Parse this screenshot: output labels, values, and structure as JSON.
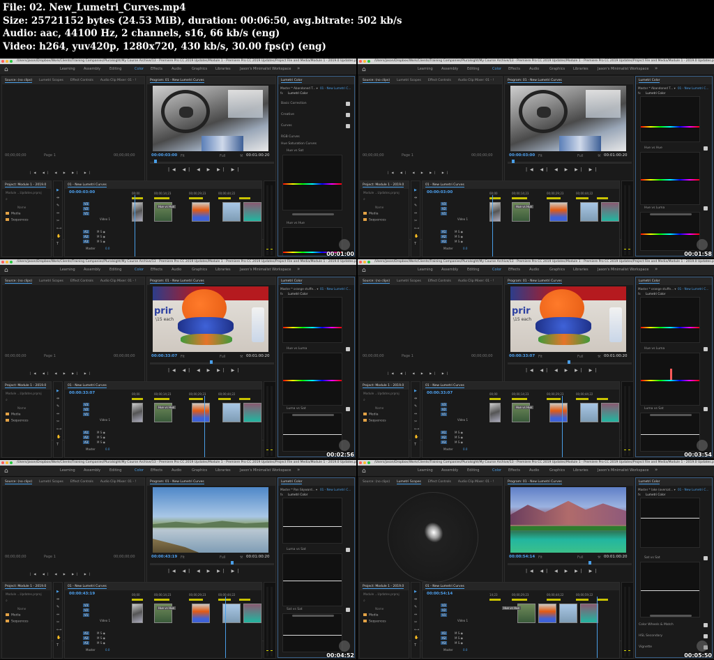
{
  "header": {
    "file_line": "File: 02. New_Lumetri_Curves.mp4",
    "size_line": "Size: 25721152 bytes (24.53 MiB), duration: 00:06:50, avg.bitrate: 502 kb/s",
    "audio_line": "Audio: aac, 44100 Hz, 2 channels, s16, 66 kb/s (eng)",
    "video_line": "Video: h264, yuv420p, 1280x720, 430 kb/s, 30.00 fps(r) (eng)"
  },
  "app": {
    "titlebar_text": "/Users/jason/Dropbox/Work/Clients/Training Companies/Pluralsight/My Course Archive/13 - Premiere Pro CC 2019 Updates/Module 1 - Premiere Pro CC 2019 Updates/Project File and Media/Module 1 - 2019.0 Updates.prproj *",
    "workspaces": [
      "Learning",
      "Assembly",
      "Editing",
      "Color",
      "Effects",
      "Audio",
      "Graphics",
      "Libraries",
      "Jason's Minimalist Workspace"
    ],
    "active_workspace": "Color",
    "more_chevron": "»",
    "home_icon": "⌂"
  },
  "common": {
    "source_tabs": [
      "Source: (no clips)",
      "Lumetri Scopes",
      "Effect Controls",
      "Audio Clip Mixer: 01 - !"
    ],
    "program_tab": "Program: 01 - New Lumetri Curves",
    "lumetri_tab": "Lumetri Color",
    "lumetri_fx": "Lumetri Color",
    "project_tab": "Project: Module 1 - 2019.0",
    "project_file": "Module ...Updates.prproj",
    "project_name_header": "Name",
    "project_items": [
      "Media",
      "Sequences"
    ],
    "sequence_tab": "01 - New Lumetri Curves",
    "source_tc_left": "00;00;00;00",
    "source_page": "Page 1",
    "source_tc_right": "00;00;00;00",
    "fit_label": "Fit",
    "full_label": "Full",
    "duration": "00:01:00:20",
    "ruler": [
      "00;00",
      "00;00;14;23",
      "00;00;29;23",
      "00;00;44;22"
    ],
    "video_track": "Video 1",
    "tracks_v": [
      "V3",
      "V2",
      "V1"
    ],
    "tracks_a": [
      "A1",
      "A2",
      "A3"
    ],
    "master_label": "Master",
    "master_value": "0.0",
    "clip_label": "Hue vs Hue",
    "transport": "|◀ ◀| ◀ ▶ ▶| ▶|"
  },
  "frames": [
    {
      "master_select": "Master * Abandoned T... ▾",
      "seq_select": "01 - New Lumetri C...",
      "playhead_tc": "00:00:03:00",
      "timeline_tc": "00:00:03:00",
      "timestamp": "00:01:00",
      "lumetri_rows": [
        "Basic Correction",
        "Creative",
        "Curves",
        "RGB Curves",
        "Hue Saturation Curves"
      ],
      "graph_labels": [
        "Hue vs Sat",
        "Hue vs Hue"
      ]
    },
    {
      "master_select": "Master * Abandoned T... ▾",
      "seq_select": "01 - New Lumetri C...",
      "playhead_tc": "00:00:03:00",
      "timeline_tc": "00:00:03:00",
      "timestamp": "00:01:58",
      "graph_labels": [
        "Hue vs Hue",
        "Hue vs Luma"
      ]
    },
    {
      "master_select": "Master * orange stuffe... ▾",
      "seq_select": "01 - New Lumetri C...",
      "playhead_tc": "00:00:33:07",
      "timeline_tc": "00:00:33:07",
      "timestamp": "00:02:56",
      "graph_labels": [
        "Hue vs Luma",
        "Luma vs Sat"
      ],
      "print_text": "prir",
      "price_text": "\\15 each"
    },
    {
      "master_select": "Master * orange stuffe... ▾",
      "seq_select": "01 - New Lumetri C...",
      "playhead_tc": "00:00:33:07",
      "timeline_tc": "00:00:33:07",
      "timestamp": "00:03:54",
      "graph_labels": [
        "Hue vs Luma",
        "Luma vs Sat"
      ],
      "print_text": "prir",
      "price_text": "\\15 each"
    },
    {
      "master_select": "Master * Pan Skyward... ▾",
      "seq_select": "01 - New Lumetri C...",
      "playhead_tc": "00:00:43:19",
      "timeline_tc": "00:00:43:19",
      "timestamp": "00:04:52",
      "graph_labels": [
        "Luma vs Sat",
        "Sat vs Sat"
      ]
    },
    {
      "master_select": "Master * lake (oversat... ▾",
      "seq_select": "01 - New Lumetri C...",
      "playhead_tc": "00:00:54:14",
      "timeline_tc": "00:00:54:14",
      "timestamp": "00:05:50",
      "graph_labels": [
        "Sat vs Sat"
      ],
      "lumetri_rows_bottom": [
        "Color Wheels & Match",
        "HSL Secondary",
        "Vignette"
      ],
      "clamp_signal": "Clamp Signal",
      "bit_depth": "8 Bit",
      "ruler_alt": [
        "14;23",
        "00;00;29;23",
        "00;00;44;22",
        "00;00;59;22"
      ]
    }
  ],
  "colors": {
    "accent": "#4a9fe8",
    "folder": "#e3a245",
    "panel_bg": "#1a1a1a"
  }
}
